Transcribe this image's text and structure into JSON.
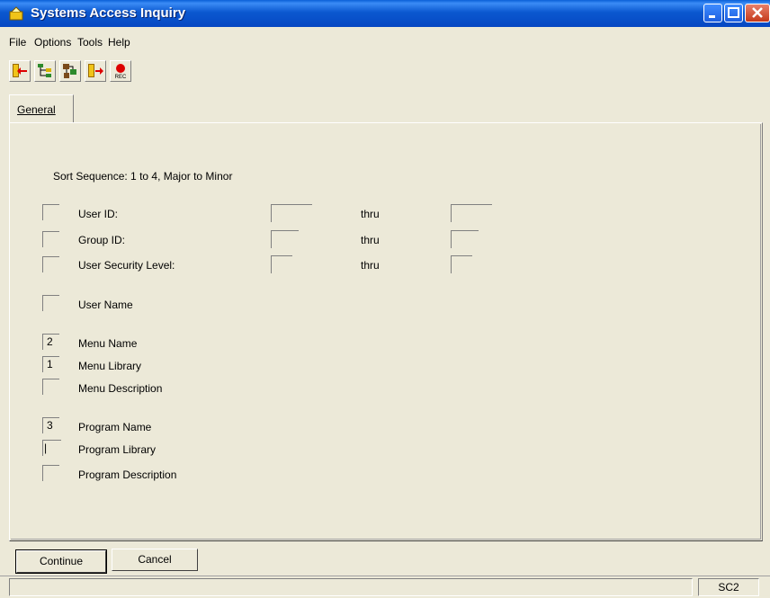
{
  "window": {
    "title": "Systems Access Inquiry"
  },
  "menu": [
    "File",
    "Options",
    "Tools",
    "Help"
  ],
  "toolbar": [
    {
      "name": "exit-left-icon"
    },
    {
      "name": "tree-icon"
    },
    {
      "name": "network-icon"
    },
    {
      "name": "exit-right-icon"
    },
    {
      "name": "record-icon",
      "text": "REC"
    }
  ],
  "tab": {
    "label": "General"
  },
  "form": {
    "sort_label": "Sort Sequence: 1 to 4, Major to Minor",
    "thru": "thru",
    "ranges": [
      {
        "label": "User ID:",
        "seq": ""
      },
      {
        "label": "Group ID:",
        "seq": ""
      },
      {
        "label": "User Security Level:",
        "seq": ""
      }
    ],
    "fields": [
      {
        "label": "User Name",
        "seq": ""
      },
      {
        "label": "Menu Name",
        "seq": "2"
      },
      {
        "label": "Menu Library",
        "seq": "1"
      },
      {
        "label": "Menu Description",
        "seq": ""
      },
      {
        "label": "Program Name",
        "seq": "3"
      },
      {
        "label": "Program Library",
        "seq": "|"
      },
      {
        "label": "Program Description",
        "seq": ""
      }
    ]
  },
  "buttons": {
    "continue": "Continue",
    "cancel": "Cancel"
  },
  "status": {
    "code": "SC2"
  }
}
